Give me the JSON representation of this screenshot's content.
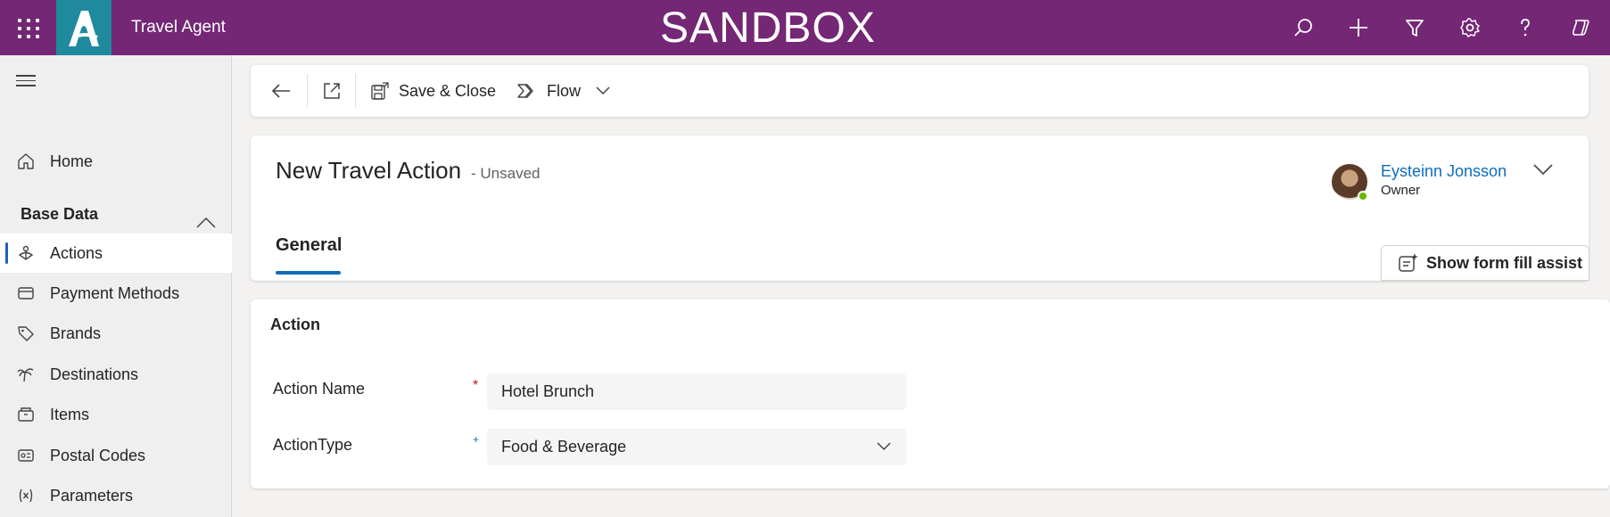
{
  "topbar": {
    "app_name": "Travel Agent",
    "environment": "SANDBOX",
    "icons": [
      "search-icon",
      "plus-icon",
      "filter-icon",
      "gear-icon",
      "help-icon",
      "copilot-icon"
    ],
    "color": "#742774"
  },
  "sidebar": {
    "home_label": "Home",
    "group_label": "Base Data",
    "items": [
      {
        "label": "Actions",
        "icon": "actions-icon",
        "active": true
      },
      {
        "label": "Payment Methods",
        "icon": "card-icon"
      },
      {
        "label": "Brands",
        "icon": "tag-icon"
      },
      {
        "label": "Destinations",
        "icon": "palm-tree-icon"
      },
      {
        "label": "Items",
        "icon": "box-icon"
      },
      {
        "label": "Postal Codes",
        "icon": "postal-icon"
      },
      {
        "label": "Parameters",
        "icon": "variable-icon"
      }
    ]
  },
  "commandbar": {
    "save_close_label": "Save & Close",
    "flow_label": "Flow"
  },
  "record": {
    "title": "New Travel Action",
    "status": "- Unsaved",
    "owner_name": "Eysteinn Jonsson",
    "owner_label": "Owner",
    "tab_general": "General",
    "assist_label": "Show form fill assist"
  },
  "form": {
    "section_title": "Action",
    "fields": [
      {
        "label": "Action Name",
        "value": "Hotel Brunch",
        "required": "*"
      },
      {
        "label": "ActionType",
        "value": "Food & Beverage",
        "required": "+"
      }
    ]
  },
  "colors": {
    "accent": "#0f6cbd",
    "required": "#c50f1f",
    "logo_bg": "#1f8a9e"
  }
}
